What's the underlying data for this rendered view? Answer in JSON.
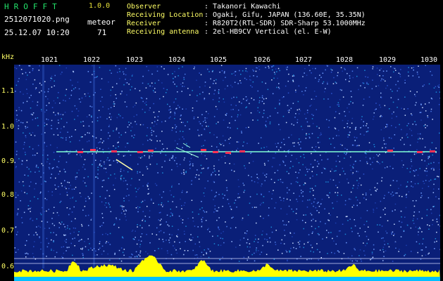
{
  "header": {
    "app_title": "HROFFT",
    "app_version": "1.0.0",
    "filename": "2512071020.png",
    "datetime": "25.12.07 10:20",
    "meteor_label": "meteor",
    "meteor_count": "71"
  },
  "info": [
    {
      "label": "Observer",
      "value": ": Takanori Kawachi"
    },
    {
      "label": "Receiving Location",
      "value": ": Ogaki, Gifu, JAPAN (136.60E, 35.35N)"
    },
    {
      "label": "Receiver",
      "value": ": R820T2(RTL-SDR) SDR-Sharp 53.1000MHz"
    },
    {
      "label": "Receiving antenna",
      "value": ": 2el-HB9CV Vertical (el. E-W)"
    }
  ],
  "spectrogram": {
    "unit_label": "kHz",
    "time_ticks": [
      "1021",
      "1022",
      "1023",
      "1024",
      "1025",
      "1026",
      "1027",
      "1028",
      "1029",
      "1030"
    ],
    "freq_ticks": [
      "1.1",
      "1.0",
      "0.9",
      "0.8",
      "0.7",
      "0.6"
    ],
    "background_color": "#0a1f78",
    "carrier_color": "#7fffd4",
    "echo_color": "#ff3355",
    "level_color": "#ffff00",
    "level_base_color": "#00bfff"
  }
}
